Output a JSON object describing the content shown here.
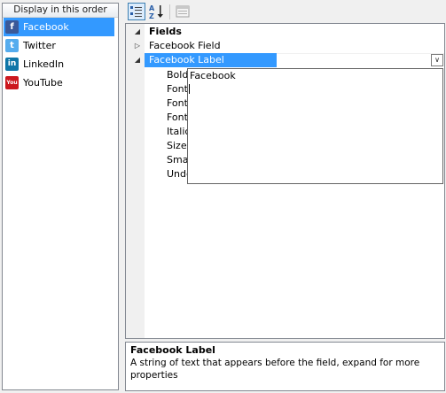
{
  "networks": {
    "header": "Display in this order",
    "items": [
      {
        "label": "Facebook",
        "icon": "facebook-icon",
        "glyph": "f",
        "color": "#3b5998",
        "selected": true
      },
      {
        "label": "Twitter",
        "icon": "twitter-icon",
        "glyph": "t",
        "color": "#55acee",
        "selected": false
      },
      {
        "label": "LinkedIn",
        "icon": "linkedin-icon",
        "glyph": "in",
        "color": "#0e76a8",
        "selected": false
      },
      {
        "label": "YouTube",
        "icon": "youtube-icon",
        "glyph": "You",
        "color": "#cc181e",
        "selected": false
      }
    ]
  },
  "toolbar": {
    "categorized_icon": "categorized-icon",
    "alphabetical_icon": "alphabetical-sort-icon",
    "pages_icon": "property-pages-icon"
  },
  "grid": {
    "category": "Fields",
    "rows": [
      {
        "name": "Facebook Field",
        "expander": "▷"
      },
      {
        "name": "Facebook Label",
        "expander": "◢"
      }
    ],
    "sub_properties": [
      "Bold",
      "Font",
      "Font",
      "Font",
      "Italic",
      "Size",
      "Small",
      "Underline"
    ],
    "category_expander": "◢",
    "dropdown_glyph": "∨",
    "popup_text": "Facebook"
  },
  "description": {
    "title": "Facebook Label",
    "text": "A string of text that appears before the field, expand for more properties"
  },
  "colors": {
    "selection": "#3399ff",
    "border": "#828790"
  }
}
